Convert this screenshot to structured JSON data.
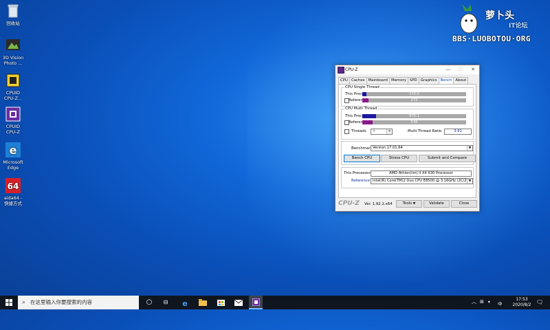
{
  "desktop": {
    "icons": [
      {
        "label": "回收站",
        "name": "recycle-bin"
      },
      {
        "label": "3D Vision Photo ...",
        "name": "3d-vision"
      },
      {
        "label": "CPUID CPU-Z...",
        "name": "cpuid-cpuz-1"
      },
      {
        "label": "CPUID CPU-Z",
        "name": "cpuid-cpuz-2"
      },
      {
        "label": "Microsoft Edge",
        "name": "edge"
      },
      {
        "label": "aida64 - 快捷方式",
        "name": "aida64"
      }
    ]
  },
  "watermark": {
    "title": "萝卜头",
    "sub": "IT论坛",
    "url": "BBS·LUOBOTOU·ORG"
  },
  "cpuz": {
    "title": "CPU-Z",
    "controls": {
      "minimize": "—",
      "maximize": "☐",
      "close": "✕"
    },
    "tabs": [
      "CPU",
      "Caches",
      "Mainboard",
      "Memory",
      "SPD",
      "Graphics",
      "Bench",
      "About"
    ],
    "active_tab": "Bench",
    "single": {
      "title": "CPU Single Thread",
      "this_label": "This Processor",
      "this_value": "172.5",
      "this_fraction": 0.04,
      "ref_label": "Reference",
      "ref_value": "272",
      "ref_fraction": 0.06
    },
    "multi": {
      "title": "CPU Multi Thread",
      "this_label": "This Processor",
      "this_value": "675.1",
      "this_fraction": 0.13,
      "ref_label": "Reference",
      "ref_value": "536",
      "ref_fraction": 0.1,
      "threads_label": "Threads",
      "threads_value": "4",
      "ratio_label": "Multi Thread Ratio",
      "ratio_value": "3.91"
    },
    "benchmark_label": "Benchmark",
    "benchmark_value": "Version 17.01.64",
    "buttons": {
      "bench": "Bench CPU",
      "stress": "Stress CPU",
      "submit": "Submit and Compare"
    },
    "processor_label": "This Processor",
    "processor_value": "AMD Athlon(tm) II X4 630 Processor",
    "reference_label": "Reference",
    "reference_value": "Intel(R) Core(TM)2 Duo CPU E8500 @ 3.16GHz (2C/2T)",
    "footer": {
      "logo": "CPU-Z",
      "version": "Ver. 1.92.2.x64",
      "tools": "Tools",
      "validate": "Validate",
      "close": "Close"
    },
    "colors": {
      "this_bar": "#1a1aa0",
      "ref_bar": "#8a1a8a",
      "bar_bg": "#a8a8a8"
    }
  },
  "taskbar": {
    "search_placeholder": "在这里输入你要搜索的内容",
    "ime": "中",
    "time": "17:53",
    "date": "2020/8/2"
  }
}
